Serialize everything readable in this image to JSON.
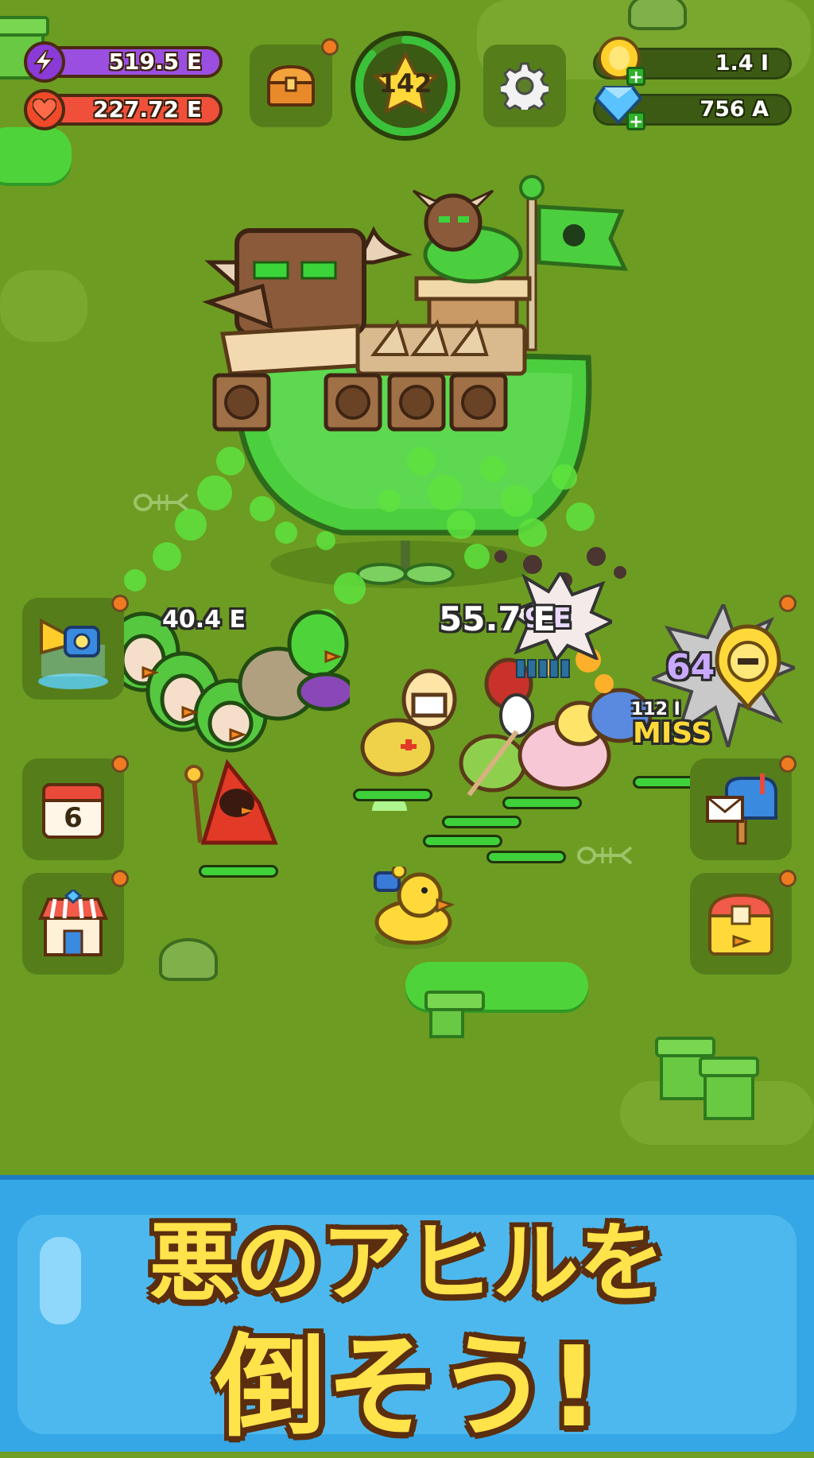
{
  "hud": {
    "energy_value": "519.5 E",
    "health_value": "227.72 E",
    "level_value": "142",
    "gold_value": "1.4 I",
    "gem_value": "756 A",
    "plus_label": "+"
  },
  "calendar": {
    "day": "6"
  },
  "damage_texts": {
    "hit_left": "40.4 E",
    "hit_center": "55.7 E",
    "hit_center_behind": "9 E",
    "hit_right": "64 E",
    "small_right": "112 I",
    "miss": "MISS"
  },
  "banner": {
    "line1": "悪のアヒルを",
    "line2": "倒そう!"
  },
  "colors": {
    "energy_bar": "#9b4fe0",
    "health_bar": "#f0503a",
    "level_ring": "#3bc23a",
    "banner_text": "#ffe34a",
    "banner_bg": "#35a7e6"
  },
  "icons": {
    "energy": "lightning-icon",
    "health": "heart-icon",
    "chest": "treasure-chest-icon",
    "level": "star-icon",
    "settings": "gear-icon",
    "gold": "coin-icon",
    "gem": "diamond-icon",
    "trumpet": "trumpet-icon",
    "calendar": "calendar-icon",
    "shop": "shop-icon",
    "mailbox": "mailbox-icon",
    "duck_chest": "duck-chest-icon",
    "ability": "duck-ability-icon"
  }
}
